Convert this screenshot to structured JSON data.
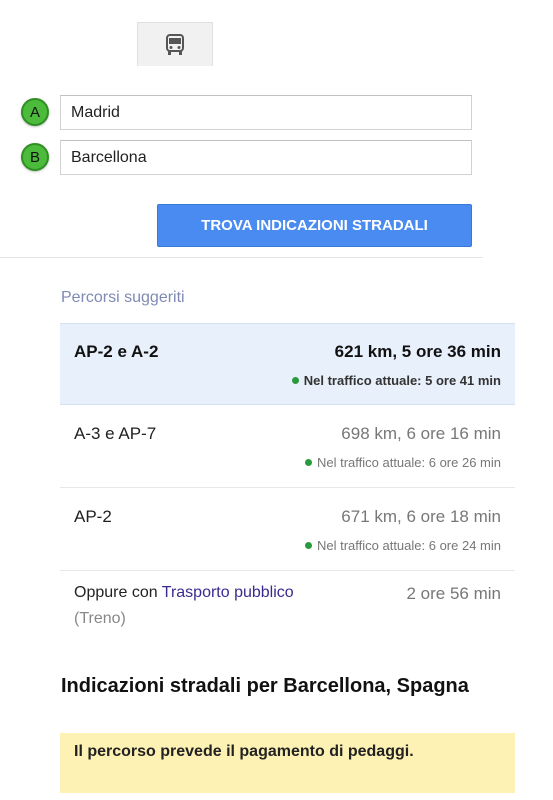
{
  "travel_modes": {
    "selected_icon": "bus-icon"
  },
  "waypoints": [
    {
      "marker": "A",
      "value": "Madrid"
    },
    {
      "marker": "B",
      "value": "Barcellona"
    }
  ],
  "find_button_label": "TROVA INDICAZIONI STRADALI",
  "suggested_title": "Percorsi suggeriti",
  "routes": [
    {
      "name": "AP-2 e A-2",
      "summary": "621 km, 5 ore 36 min",
      "traffic": "Nel traffico attuale: 5 ore 41 min",
      "selected": true
    },
    {
      "name": "A-3 e AP-7",
      "summary": "698 km, 6 ore 16 min",
      "traffic": "Nel traffico attuale: 6 ore 26 min",
      "selected": false
    },
    {
      "name": "AP-2",
      "summary": "671 km, 6 ore 18 min",
      "traffic": "Nel traffico attuale: 6 ore 24 min",
      "selected": false
    }
  ],
  "transit_option": {
    "prefix": "Oppure con",
    "link_text": "Trasporto pubblico",
    "mode": "(Treno)",
    "time": "2 ore 56 min"
  },
  "directions_heading": "Indicazioni stradali per Barcellona, Spagna",
  "toll_notice": "Il percorso prevede il pagamento di pedaggi.",
  "colors": {
    "accent_button": "#4a8bf2",
    "marker_green": "#4cbb3c",
    "selected_route_bg": "#e8f0fb",
    "traffic_dot": "#2a9a3c",
    "toll_notice_bg": "#fdf2b4",
    "link": "#3b2a8f"
  }
}
